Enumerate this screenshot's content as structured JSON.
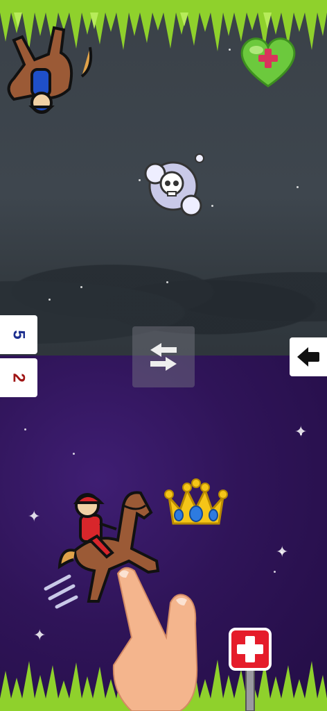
{
  "scores": {
    "opponent": "5",
    "player": "2"
  },
  "icons": {
    "swap": "swap-arrows-icon",
    "back": "back-arrow-icon",
    "health_heart": "heart-plus-icon",
    "first_aid": "first-aid-sign-icon",
    "crown": "crown-icon",
    "skull_cloud": "skull-cloud-icon"
  },
  "colors": {
    "top_background": "#3e464e",
    "bottom_background": "#2f1458",
    "grass": "#8fd12c",
    "player_jockey": "#d8262b",
    "opponent_jockey": "#1f4fc8",
    "heart": "#6cc93d",
    "first_aid": "#e51c2a"
  }
}
